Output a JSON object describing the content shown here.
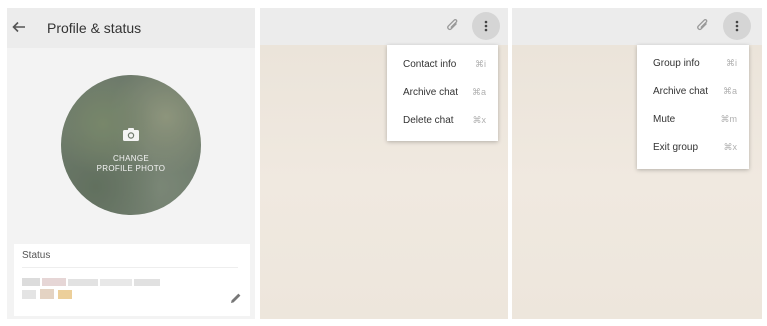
{
  "profile": {
    "title": "Profile & status",
    "avatar_prompt_line1": "CHANGE",
    "avatar_prompt_line2": "PROFILE PHOTO",
    "status_label": "Status",
    "icons": {
      "back": "arrow-left-icon",
      "camera": "camera-icon",
      "edit": "pencil-icon"
    }
  },
  "contact_chat": {
    "icons": {
      "attach": "paperclip-icon",
      "menu": "more-vert-icon"
    },
    "menu": [
      {
        "label": "Contact info",
        "shortcut": "⌘i"
      },
      {
        "label": "Archive chat",
        "shortcut": "⌘a"
      },
      {
        "label": "Delete chat",
        "shortcut": "⌘x"
      }
    ]
  },
  "group_chat": {
    "icons": {
      "attach": "paperclip-icon",
      "menu": "more-vert-icon"
    },
    "menu": [
      {
        "label": "Group info",
        "shortcut": "⌘i"
      },
      {
        "label": "Archive chat",
        "shortcut": "⌘a"
      },
      {
        "label": "Mute",
        "shortcut": "⌘m"
      },
      {
        "label": "Exit group",
        "shortcut": "⌘x"
      }
    ]
  },
  "colors": {
    "header_bg": "#ececec",
    "chat_wallpaper": "#efe8df",
    "menu_button_bg": "#d5d5d5",
    "shortcut_text": "#b0b0b0"
  }
}
